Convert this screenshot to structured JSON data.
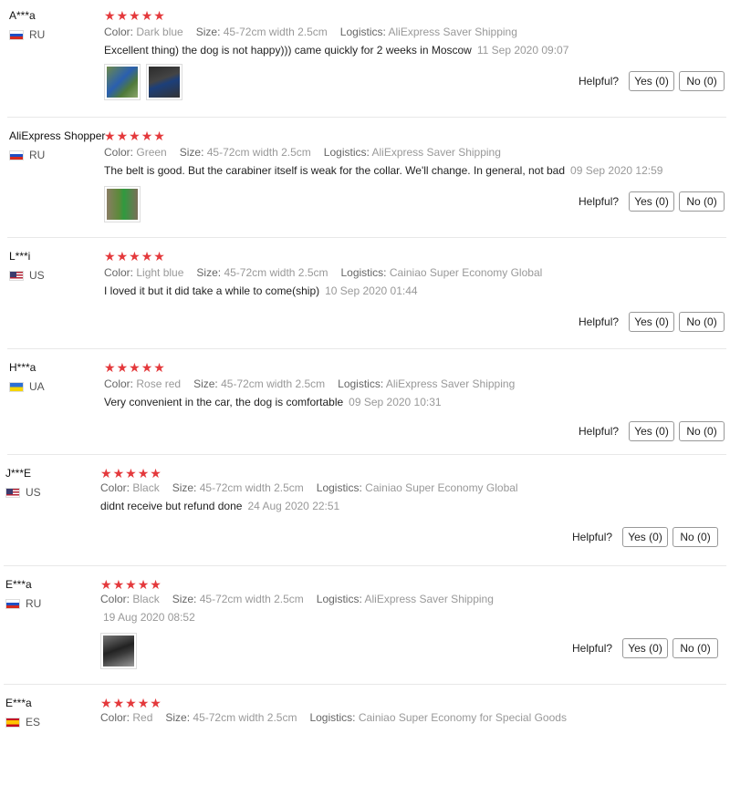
{
  "labels": {
    "color": "Color:",
    "size": "Size:",
    "logistics": "Logistics:",
    "helpful": "Helpful?",
    "yes": "Yes (0)",
    "no": "No (0)"
  },
  "colors": {
    "star": "#e4393c",
    "divider": "#e8e8e8"
  },
  "reviews": [
    {
      "user": "A***a",
      "country": "RU",
      "flag": "russia-flag",
      "rating": 5,
      "color": "Dark blue",
      "size": "45-72cm width 2.5cm",
      "logistics": "AliExpress Saver Shipping",
      "text": "Excellent thing) the dog is not happy))) came quickly for 2 weeks in Moscow",
      "date": "11 Sep 2020 09:07",
      "photos": [
        "photo-blue-harness-on-grass",
        "photo-car-seat-belt"
      ]
    },
    {
      "user": "AliExpress Shopper",
      "country": "RU",
      "flag": "russia-flag",
      "rating": 5,
      "color": "Green",
      "size": "45-72cm width 2.5cm",
      "logistics": "AliExpress Saver Shipping",
      "text": "The belt is good. But the carabiner itself is weak for the collar. We'll change. In general, not bad",
      "date": "09 Sep 2020 12:59",
      "photos": [
        "photo-green-belt"
      ]
    },
    {
      "user": "L***i",
      "country": "US",
      "flag": "usa-flag",
      "rating": 5,
      "color": "Light blue",
      "size": "45-72cm width 2.5cm",
      "logistics": "Cainiao Super Economy Global",
      "text": "I loved it but it did take a while to come(ship)",
      "date": "10 Sep 2020 01:44",
      "photos": []
    },
    {
      "user": "H***a",
      "country": "UA",
      "flag": "ukraine-flag",
      "rating": 5,
      "color": "Rose red",
      "size": "45-72cm width 2.5cm",
      "logistics": "AliExpress Saver Shipping",
      "text": "Very convenient in the car, the dog is comfortable",
      "date": "09 Sep 2020 10:31",
      "photos": []
    },
    {
      "user": "J***E",
      "country": "US",
      "flag": "usa-flag",
      "rating": 5,
      "color": "Black",
      "size": "45-72cm width 2.5cm",
      "logistics": "Cainiao Super Economy Global",
      "text": "didnt receive but refund done",
      "date": "24 Aug 2020 22:51",
      "photos": []
    },
    {
      "user": "E***a",
      "country": "RU",
      "flag": "russia-flag",
      "rating": 5,
      "color": "Black",
      "size": "45-72cm width 2.5cm",
      "logistics": "AliExpress Saver Shipping",
      "text": "",
      "date": "19 Aug 2020 08:52",
      "photos": [
        "photo-black-belt"
      ]
    },
    {
      "user": "E***a",
      "country": "ES",
      "flag": "spain-flag",
      "rating": 5,
      "color": "Red",
      "size": "45-72cm width 2.5cm",
      "logistics": "Cainiao Super Economy for Special Goods",
      "text": "",
      "date": "",
      "photos": []
    }
  ]
}
